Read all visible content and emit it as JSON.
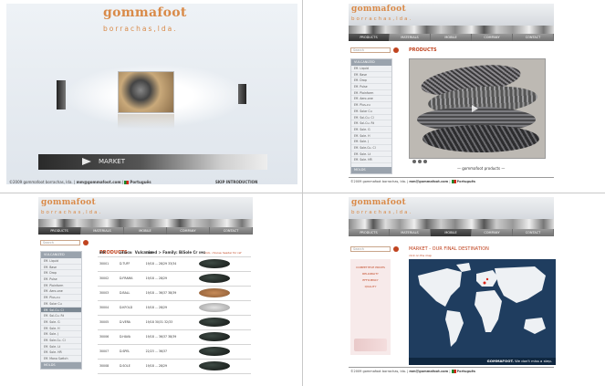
{
  "brand": {
    "logo": "gommafoot",
    "tagline": "borrachas,lda."
  },
  "nav": [
    "PRODUCTS",
    "MATERIALS",
    "MOBILE",
    "COMPANY",
    "CONTACT"
  ],
  "footer": {
    "copyright": "©2009 gommafoot borrachas, lda.",
    "email": "mm@gommafoot.com",
    "language": "Português"
  },
  "search": {
    "placeholder": "Search"
  },
  "panel1": {
    "market_label": "MARKET",
    "skip": "SKIP INTRODUCTION"
  },
  "panel2": {
    "title": "PRODUCTS",
    "categories_header": "VULCANIZED",
    "categories": [
      "Eff. Liquid",
      "Eff. Base",
      "Eff. Drop",
      "Eff. Pulse",
      "Eff. Plainform",
      "Eff. Aero-one",
      "Eff. Plus-cu",
      "Eff. Solar Cu",
      "Eff. Sol-Cu. Cl",
      "Eff. Sol-Cu. Rt",
      "Eff. Sole. G",
      "Eff. Sole. H",
      "Eff. Sole. J",
      "Eff. Sole-Cu. Cl",
      "Eff. Sole. Lt",
      "Eff. Sole. HR",
      "Eff. Mono Switch",
      "Eff. Sole-Cu. HR"
    ],
    "footer_header": "MOLDS",
    "caption": "— gommafoot products —"
  },
  "panel3": {
    "title": "PRODUCTS",
    "breadcrumb": "Vulcanized > Family: BiSole Cr",
    "breadcrumb_link": "click, choose header for ref",
    "categories_header": "VULCANIZED",
    "categories": [
      "Eff. Liquid",
      "Eff. Base",
      "Eff. Drop",
      "Eff. Pulse",
      "Eff. Plainform",
      "Eff. Aero-one",
      "Eff. Plus-cu",
      "Eff. Solar Cu",
      "Eff. Sol-Cu. Cl",
      "Eff. Sol-Cu. Rt",
      "Eff. Sole. G",
      "Eff. Sole. H",
      "Eff. Sole. J",
      "Eff. Sole-Cu. Cl",
      "Eff. Sole. Lt",
      "Eff. Sole. HR",
      "Eff. Mono Switch",
      "Eff. Sole-Cu. HR"
    ],
    "selected_index": 8,
    "footer_header": "MOLDS",
    "columns": [
      "REF",
      "DESIGN",
      "TAM",
      "IMG"
    ],
    "rows": [
      {
        "ref": "30001",
        "design": "D.TUFF",
        "tam": "19/18 ... 28/29 33/34"
      },
      {
        "ref": "30002",
        "design": "D.FRAMA",
        "tam": "19/18 ... 28/29"
      },
      {
        "ref": "30003",
        "design": "D.BALL",
        "tam": "19/18 ... 36/37 38/39"
      },
      {
        "ref": "30004",
        "design": "D.KFOLD",
        "tam": "19/18 ... 28/29"
      },
      {
        "ref": "30005",
        "design": "D.VERA",
        "tam": "19/18 30/31 32/33"
      },
      {
        "ref": "30006",
        "design": "D.HAVA",
        "tam": "19/18 ... 36/37 38/39"
      },
      {
        "ref": "30007",
        "design": "D.SPEL",
        "tam": "22/23 ... 36/37"
      },
      {
        "ref": "30008",
        "design": "D.SOLE",
        "tam": "19/18 ... 28/29"
      }
    ]
  },
  "panel4": {
    "title": "MARKET - OUR FINAL DESTINATION",
    "sublink": "click on the map",
    "menu": [
      "COMPETITIVE PRICES",
      "RELIABILITY",
      "EFFICIENCY",
      "QUALITY"
    ],
    "map_caption_brand": "GOMMAFOOT.",
    "map_caption": "We don't miss a step."
  }
}
